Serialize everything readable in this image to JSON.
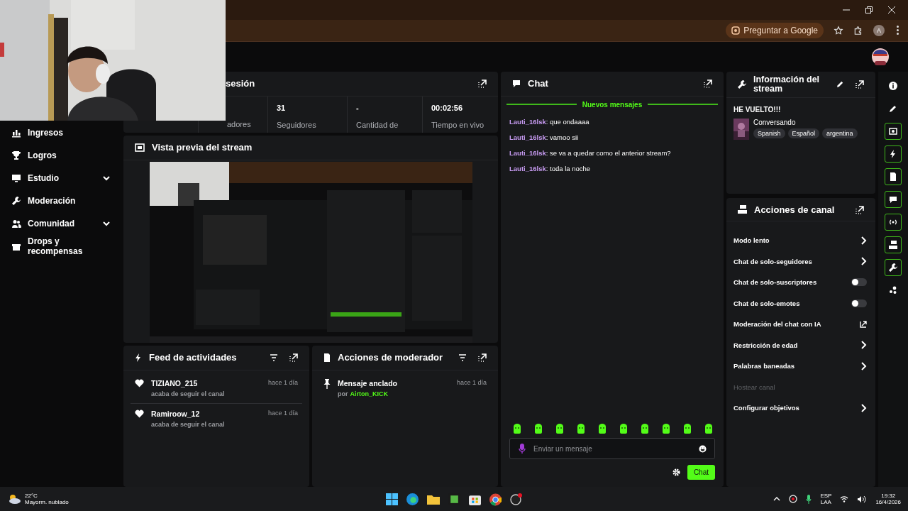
{
  "browser": {
    "ask_button": "Preguntar a Google",
    "profile": "A"
  },
  "sidebar": {
    "items": [
      {
        "label": "Ingresos",
        "expandable": false
      },
      {
        "label": "Logros",
        "expandable": false
      },
      {
        "label": "Estudio",
        "expandable": true
      },
      {
        "label": "Moderación",
        "expandable": false
      },
      {
        "label": "Comunidad",
        "expandable": true
      },
      {
        "label": "Drops y recompensas",
        "expandable": false
      }
    ]
  },
  "session": {
    "title": "sesión",
    "stats": [
      {
        "label": "adores"
      },
      {
        "value": "31",
        "label": "Seguidores"
      },
      {
        "value": "-",
        "label": "Cantidad de"
      },
      {
        "value": "00:02:56",
        "label": "Tiempo en vivo"
      }
    ]
  },
  "preview": {
    "title": "Vista previa del stream"
  },
  "activity_feed": {
    "title": "Feed de actividades",
    "items": [
      {
        "user": "TIZIANO_215",
        "action": "acaba de seguir el canal",
        "time": "hace 1 día"
      },
      {
        "user": "Ramiroow_12",
        "action": "acaba de seguir el canal",
        "time": "hace 1 día"
      }
    ]
  },
  "mod_actions": {
    "title": "Acciones de moderador",
    "items": [
      {
        "title": "Mensaje anclado",
        "by_label": "por",
        "by": "Airton_KICK",
        "time": "hace 1 día"
      }
    ]
  },
  "chat": {
    "title": "Chat",
    "divider": "Nuevos mensajes",
    "messages": [
      {
        "user": "Lauti_16lsk",
        "separator": ":",
        "text": "que ondaaaa"
      },
      {
        "user": "Lauti_16lsk",
        "separator": ":",
        "text": "vamoo sii"
      },
      {
        "user": "Lauti_16lsk",
        "separator": ":",
        "text": "se va a quedar como el anterior stream?"
      },
      {
        "user": "Lauti_16lsk",
        "separator": ":",
        "text": "toda la noche"
      }
    ],
    "placeholder": "Enviar un mensaje",
    "send_button": "Chat"
  },
  "stream_info": {
    "title": "Información del stream",
    "stream_title": "HE VUELTO!!!",
    "category": "Conversando",
    "tags": [
      "Spanish",
      "Español",
      "argentina"
    ]
  },
  "channel_actions": {
    "title": "Acciones de canal",
    "items": [
      {
        "label": "Modo lento",
        "kind": "submenu",
        "disabled": false
      },
      {
        "label": "Chat de solo-seguidores",
        "kind": "submenu",
        "disabled": false
      },
      {
        "label": "Chat de solo-suscriptores",
        "kind": "toggle",
        "on": false,
        "disabled": false
      },
      {
        "label": "Chat de solo-emotes",
        "kind": "toggle",
        "on": false,
        "disabled": false
      },
      {
        "label": "Moderación del chat con IA",
        "kind": "external",
        "disabled": false
      },
      {
        "label": "Restricción de edad",
        "kind": "submenu",
        "disabled": false
      },
      {
        "label": "Palabras baneadas",
        "kind": "submenu",
        "disabled": false
      },
      {
        "label": "Hostear canal",
        "kind": "plain",
        "disabled": true
      },
      {
        "label": "Configurar objetivos",
        "kind": "submenu",
        "disabled": false
      }
    ]
  },
  "rail": [
    {
      "kind": "info",
      "outlined": false
    },
    {
      "kind": "pencil",
      "outlined": false
    },
    {
      "kind": "capture",
      "outlined": true
    },
    {
      "kind": "bolt",
      "outlined": true
    },
    {
      "kind": "doc",
      "outlined": true
    },
    {
      "kind": "chat",
      "outlined": true
    },
    {
      "kind": "broadcast",
      "outlined": true
    },
    {
      "kind": "actions",
      "outlined": true
    },
    {
      "kind": "wrench",
      "outlined": true
    },
    {
      "kind": "dots",
      "outlined": false
    }
  ],
  "taskbar": {
    "temperature": "22°C",
    "weather": "Mayorm. nublado",
    "lang": "ESP",
    "layout": "LAA",
    "time": "19:32",
    "date": "16/4/2026"
  }
}
